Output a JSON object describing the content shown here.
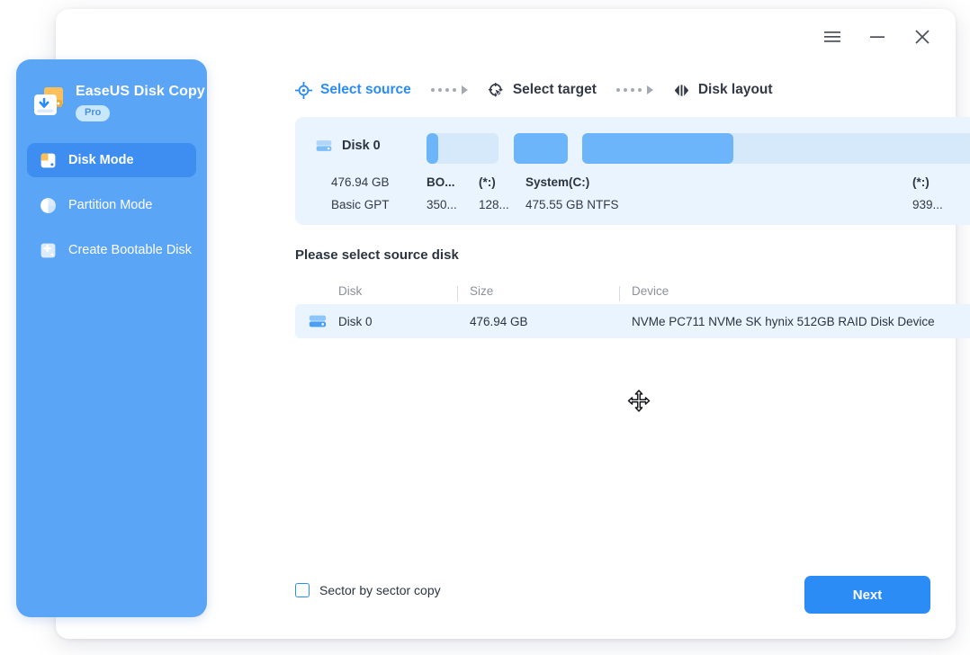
{
  "window": {
    "controls": [
      {
        "name": "menu",
        "glyph": "hamburger"
      },
      {
        "name": "minimize",
        "glyph": "minus"
      },
      {
        "name": "close",
        "glyph": "cross"
      }
    ]
  },
  "sidebar": {
    "brand_name": "EaseUS Disk Copy",
    "badge": "Pro",
    "items": [
      {
        "label": "Disk Mode",
        "icon": "disk-mode-icon",
        "active": true
      },
      {
        "label": "Partition Mode",
        "icon": "partition-mode-icon",
        "active": false
      },
      {
        "label": "Create Bootable Disk",
        "icon": "create-bootable-disk-icon",
        "active": false
      }
    ]
  },
  "steps": [
    {
      "label": "Select source",
      "icon": "target-crosshair-icon",
      "active": true
    },
    {
      "label": "Select target",
      "icon": "target-pointer-icon",
      "active": false
    },
    {
      "label": "Disk layout",
      "icon": "disk-layout-icon",
      "active": false
    }
  ],
  "disk_panel": {
    "icon": "hard-disk-icon",
    "disk_name": "Disk 0",
    "capacity": "476.94 GB",
    "scheme": "Basic GPT",
    "partitions": [
      {
        "name": "BO...",
        "detail": "350...",
        "left_pct": 0.0,
        "width_pct": 2.2,
        "fill": "used"
      },
      {
        "name": "",
        "detail": "",
        "left_pct": 0.0,
        "width_pct": 13.3,
        "fill": "free"
      },
      {
        "name": "(*:)",
        "detail": "128...",
        "left_pct": 16.2,
        "width_pct": 10.0,
        "fill": "used"
      },
      {
        "name": "System(C:)",
        "detail": "475.55 GB NTFS",
        "left_pct": 28.8,
        "width_pct": 75.8,
        "fill": "free"
      },
      {
        "name": "",
        "detail": "",
        "left_pct": 28.8,
        "width_pct": 28.0,
        "fill": "used"
      },
      {
        "name": "(*:)",
        "detail": "939...",
        "left_pct": 93.0,
        "width_pct": 7.0,
        "fill": "used"
      }
    ]
  },
  "table": {
    "section_title": "Please select source disk",
    "headers": [
      "Disk",
      "Size",
      "Device"
    ],
    "rows": [
      {
        "icon": "hard-disk-icon",
        "disk": "Disk 0",
        "size": "476.94 GB",
        "device": "NVMe PC711 NVMe SK hynix 512GB RAID Disk Device",
        "selected": true
      }
    ]
  },
  "footer": {
    "checkbox_label": "Sector by sector copy",
    "checkbox_checked": false,
    "next_label": "Next"
  },
  "colors": {
    "accent": "#2b8cf5",
    "sidebar": "#5ba5f7",
    "sidebar_active": "#3d8ef0",
    "panel_bg": "#eaf4fe",
    "partition_used": "#6cb5fa",
    "partition_free": "#d6e9fb",
    "badge_bg": "#c8e7fb"
  },
  "cursor": {
    "type": "move-cursor"
  }
}
